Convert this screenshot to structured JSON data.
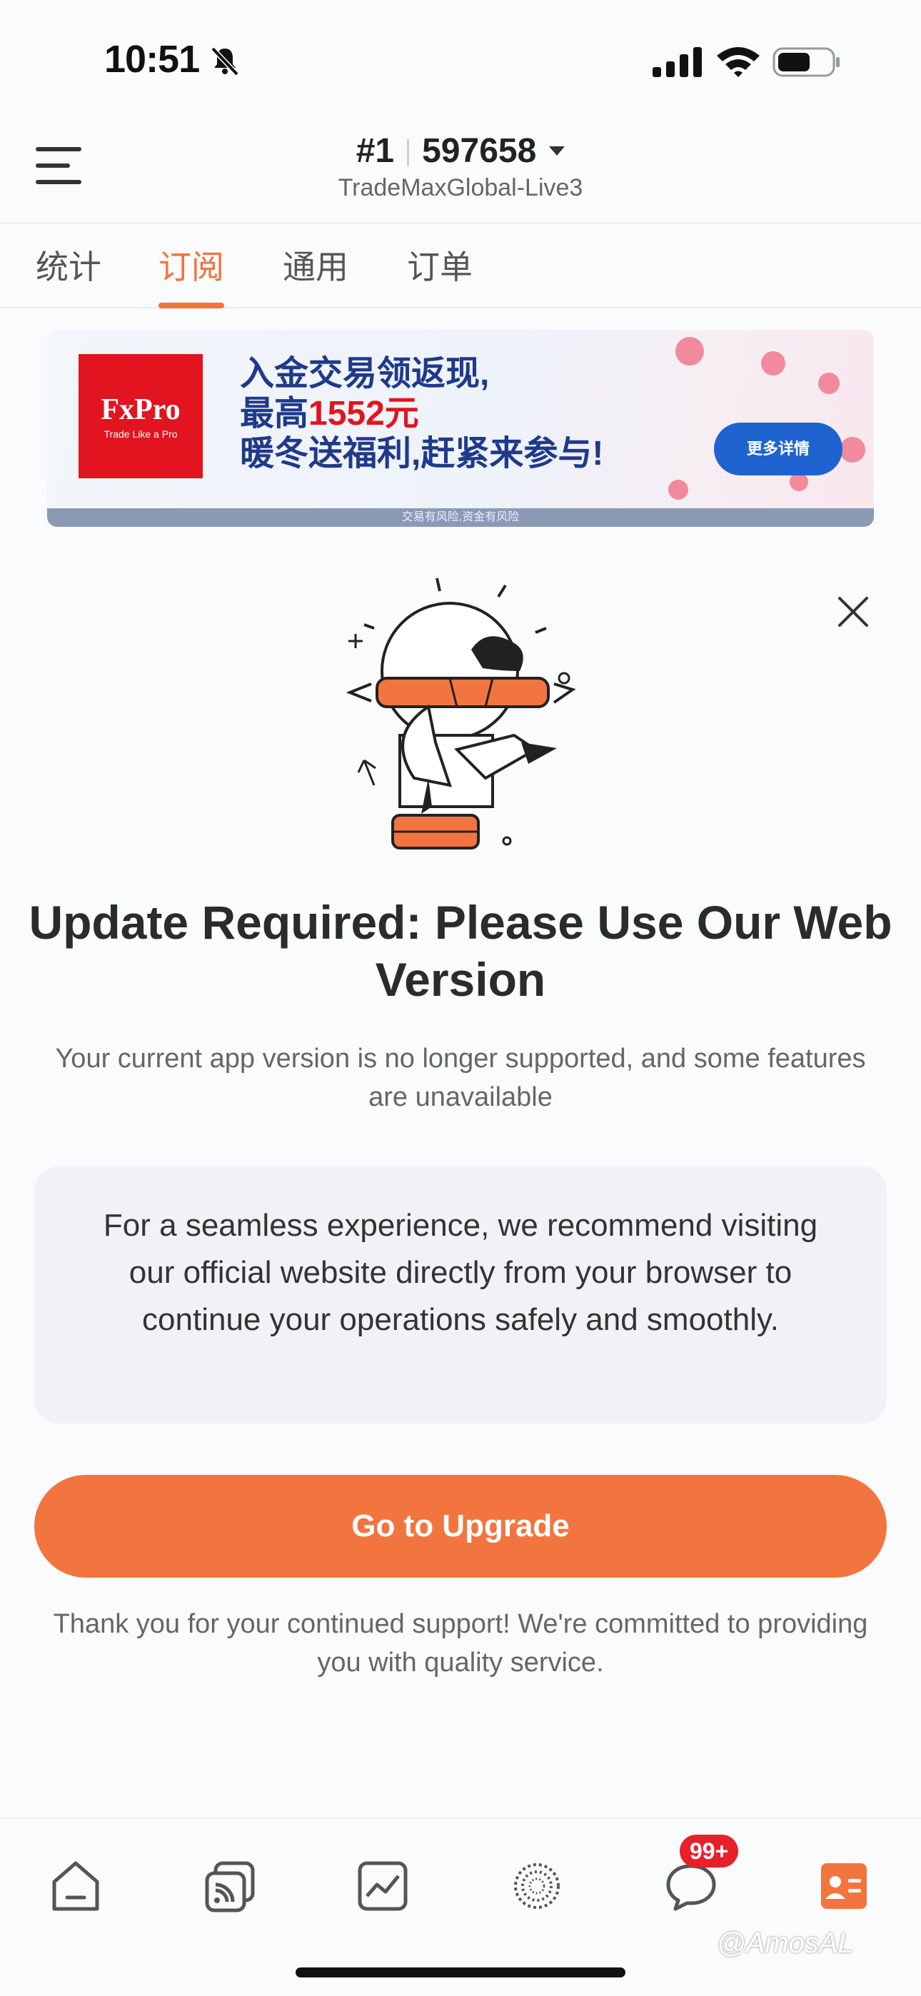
{
  "status_bar": {
    "time": "10:51"
  },
  "header": {
    "account_number": "#1",
    "account_id": "597658",
    "server": "TradeMaxGlobal-Live3"
  },
  "tabs": [
    {
      "label": "统计"
    },
    {
      "label": "订阅"
    },
    {
      "label": "通用"
    },
    {
      "label": "订单"
    }
  ],
  "banner": {
    "logo_main": "FxPro",
    "logo_tagline": "Trade Like a Pro",
    "line1": "入金交易领返现,",
    "line2_prefix": "最高",
    "line2_amount": "1552元",
    "line3": "暖冬送福利,赶紧来参与!",
    "button": "更多详情",
    "footer": "交易有风险,资金有风险"
  },
  "modal": {
    "title": "Update Required: Please Use Our Web Version",
    "subtitle": "Your current app version is no longer supported, and some features are unavailable",
    "info": "For a seamless experience, we recommend visiting our official website directly from your browser to continue your operations safely and smoothly.",
    "button": "Go to Upgrade",
    "thanks": "Thank you for your continued support! We're committed to providing you with quality service."
  },
  "bottom_nav": {
    "items": [
      "home-icon",
      "copy-trading-icon",
      "chart-icon",
      "discover-icon",
      "chat-icon",
      "profile-card-icon"
    ],
    "badge": "99+"
  },
  "watermark": "@AmosAL",
  "colors": {
    "accent": "#f27540",
    "badge": "#e8202a",
    "banner_blue": "#1f3a8a",
    "fxpro_red": "#e1141f"
  }
}
